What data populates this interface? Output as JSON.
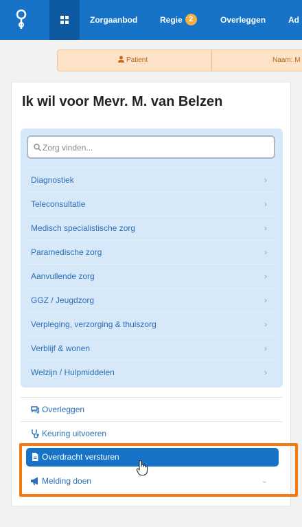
{
  "nav": {
    "items": [
      {
        "label": "Zorgaanbod"
      },
      {
        "label": "Regie",
        "badge": "2"
      },
      {
        "label": "Overleggen"
      },
      {
        "label": "Ad"
      }
    ]
  },
  "patient_bar": {
    "patient_label": "Patient",
    "naam_label": "Naam: M"
  },
  "panel": {
    "title": "Ik wil voor Mevr. M. van Belzen",
    "search_placeholder": "Zorg vinden...",
    "categories": [
      {
        "label": "Diagnostiek"
      },
      {
        "label": "Teleconsultatie"
      },
      {
        "label": "Medisch specialistische zorg"
      },
      {
        "label": "Paramedische zorg"
      },
      {
        "label": "Aanvullende zorg"
      },
      {
        "label": "GGZ / Jeugdzorg"
      },
      {
        "label": "Verpleging, verzorging & thuiszorg"
      },
      {
        "label": "Verblijf & wonen"
      },
      {
        "label": "Welzijn / Hulpmiddelen"
      }
    ],
    "actions": [
      {
        "label": "Overleggen",
        "icon": "chat-icon"
      },
      {
        "label": "Keuring uitvoeren",
        "icon": "stethoscope-icon"
      },
      {
        "label": "Overdracht versturen",
        "icon": "document-icon",
        "active": true
      },
      {
        "label": "Melding doen",
        "icon": "megaphone-icon"
      }
    ]
  },
  "colors": {
    "primary": "#1673c8",
    "nav_active": "#0d5aa3",
    "patient_bar": "#fde2c8",
    "category_box": "#d7e8f8",
    "link": "#2c6fb7",
    "badge": "#f5b041",
    "highlight": "#f47a0f"
  }
}
